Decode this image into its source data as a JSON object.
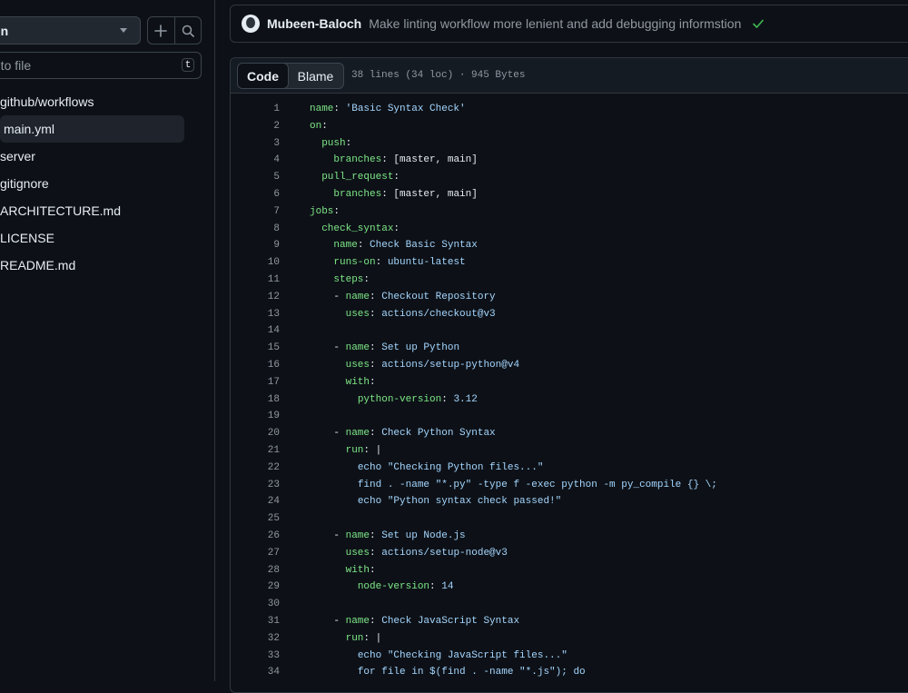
{
  "sidebar": {
    "branch": "ain",
    "filter_placeholder": "o to file",
    "filter_shortcut": "t",
    "items": [
      {
        "label": "github/workflows",
        "active": false
      },
      {
        "label": "main.yml",
        "active": true
      },
      {
        "label": "server",
        "active": false
      },
      {
        "label": "gitignore",
        "active": false
      },
      {
        "label": "ARCHITECTURE.md",
        "active": false
      },
      {
        "label": "LICENSE",
        "active": false
      },
      {
        "label": "README.md",
        "active": false
      }
    ]
  },
  "commit": {
    "author": "Mubeen-Baloch",
    "message": "Make linting workflow more lenient and add debugging informstion",
    "status_icon": "check-icon",
    "status_color": "#3fb950"
  },
  "code_view": {
    "tabs": [
      "Code",
      "Blame"
    ],
    "active_tab": "Code",
    "file_info": "38 lines (34 loc) · 945 Bytes"
  },
  "colors": {
    "background": "#0d1117",
    "key": "#7ee787",
    "string": "#a5d6ff",
    "text": "#e6edf3",
    "muted": "#9198a1"
  },
  "code_lines": [
    {
      "n": "1",
      "indent": "",
      "dash": false,
      "key": "name",
      "colon": ":",
      "value": " 'Basic Syntax Check'",
      "vtype": "str"
    },
    {
      "n": "2",
      "indent": "",
      "dash": false,
      "key": "on",
      "colon": ":",
      "value": "",
      "vtype": "plain"
    },
    {
      "n": "3",
      "indent": "  ",
      "dash": false,
      "key": "push",
      "colon": ":",
      "value": "",
      "vtype": "plain"
    },
    {
      "n": "4",
      "indent": "    ",
      "dash": false,
      "key": "branches",
      "colon": ":",
      "value": " [master, main]",
      "vtype": "plain"
    },
    {
      "n": "5",
      "indent": "  ",
      "dash": false,
      "key": "pull_request",
      "colon": ":",
      "value": "",
      "vtype": "plain"
    },
    {
      "n": "6",
      "indent": "    ",
      "dash": false,
      "key": "branches",
      "colon": ":",
      "value": " [master, main]",
      "vtype": "plain"
    },
    {
      "n": "7",
      "indent": "",
      "dash": false,
      "key": "jobs",
      "colon": ":",
      "value": "",
      "vtype": "plain"
    },
    {
      "n": "8",
      "indent": "  ",
      "dash": false,
      "key": "check_syntax",
      "colon": ":",
      "value": "",
      "vtype": "plain"
    },
    {
      "n": "9",
      "indent": "    ",
      "dash": false,
      "key": "name",
      "colon": ":",
      "value": " Check Basic Syntax",
      "vtype": "str"
    },
    {
      "n": "10",
      "indent": "    ",
      "dash": false,
      "key": "runs-on",
      "colon": ":",
      "value": " ubuntu-latest",
      "vtype": "str"
    },
    {
      "n": "11",
      "indent": "    ",
      "dash": false,
      "key": "steps",
      "colon": ":",
      "value": "",
      "vtype": "plain"
    },
    {
      "n": "12",
      "indent": "    ",
      "dash": true,
      "key": "name",
      "colon": ":",
      "value": " Checkout Repository",
      "vtype": "str"
    },
    {
      "n": "13",
      "indent": "      ",
      "dash": false,
      "key": "uses",
      "colon": ":",
      "value": " actions/checkout@v3",
      "vtype": "str"
    },
    {
      "n": "14",
      "indent": "",
      "dash": false,
      "key": "",
      "colon": "",
      "value": "",
      "vtype": "plain"
    },
    {
      "n": "15",
      "indent": "    ",
      "dash": true,
      "key": "name",
      "colon": ":",
      "value": " Set up Python",
      "vtype": "str"
    },
    {
      "n": "16",
      "indent": "      ",
      "dash": false,
      "key": "uses",
      "colon": ":",
      "value": " actions/setup-python@v4",
      "vtype": "str"
    },
    {
      "n": "17",
      "indent": "      ",
      "dash": false,
      "key": "with",
      "colon": ":",
      "value": "",
      "vtype": "plain"
    },
    {
      "n": "18",
      "indent": "        ",
      "dash": false,
      "key": "python-version",
      "colon": ":",
      "value": " 3.12",
      "vtype": "str"
    },
    {
      "n": "19",
      "indent": "",
      "dash": false,
      "key": "",
      "colon": "",
      "value": "",
      "vtype": "plain"
    },
    {
      "n": "20",
      "indent": "    ",
      "dash": true,
      "key": "name",
      "colon": ":",
      "value": " Check Python Syntax",
      "vtype": "str"
    },
    {
      "n": "21",
      "indent": "      ",
      "dash": false,
      "key": "run",
      "colon": ":",
      "value": " |",
      "vtype": "plain"
    },
    {
      "n": "22",
      "indent": "        ",
      "dash": false,
      "key": "",
      "colon": "",
      "value": "echo \"Checking Python files...\"",
      "vtype": "str"
    },
    {
      "n": "23",
      "indent": "        ",
      "dash": false,
      "key": "",
      "colon": "",
      "value": "find . -name \"*.py\" -type f -exec python -m py_compile {} \\;",
      "vtype": "str"
    },
    {
      "n": "24",
      "indent": "        ",
      "dash": false,
      "key": "",
      "colon": "",
      "value": "echo \"Python syntax check passed!\"",
      "vtype": "str"
    },
    {
      "n": "25",
      "indent": "",
      "dash": false,
      "key": "",
      "colon": "",
      "value": "",
      "vtype": "plain"
    },
    {
      "n": "26",
      "indent": "    ",
      "dash": true,
      "key": "name",
      "colon": ":",
      "value": " Set up Node.js",
      "vtype": "str"
    },
    {
      "n": "27",
      "indent": "      ",
      "dash": false,
      "key": "uses",
      "colon": ":",
      "value": " actions/setup-node@v3",
      "vtype": "str"
    },
    {
      "n": "28",
      "indent": "      ",
      "dash": false,
      "key": "with",
      "colon": ":",
      "value": "",
      "vtype": "plain"
    },
    {
      "n": "29",
      "indent": "        ",
      "dash": false,
      "key": "node-version",
      "colon": ":",
      "value": " 14",
      "vtype": "str"
    },
    {
      "n": "30",
      "indent": "",
      "dash": false,
      "key": "",
      "colon": "",
      "value": "",
      "vtype": "plain"
    },
    {
      "n": "31",
      "indent": "    ",
      "dash": true,
      "key": "name",
      "colon": ":",
      "value": " Check JavaScript Syntax",
      "vtype": "str"
    },
    {
      "n": "32",
      "indent": "      ",
      "dash": false,
      "key": "run",
      "colon": ":",
      "value": " |",
      "vtype": "plain"
    },
    {
      "n": "33",
      "indent": "        ",
      "dash": false,
      "key": "",
      "colon": "",
      "value": "echo \"Checking JavaScript files...\"",
      "vtype": "str"
    },
    {
      "n": "34",
      "indent": "        ",
      "dash": false,
      "key": "",
      "colon": "",
      "value": "for file in $(find . -name \"*.js\"); do",
      "vtype": "str"
    }
  ]
}
